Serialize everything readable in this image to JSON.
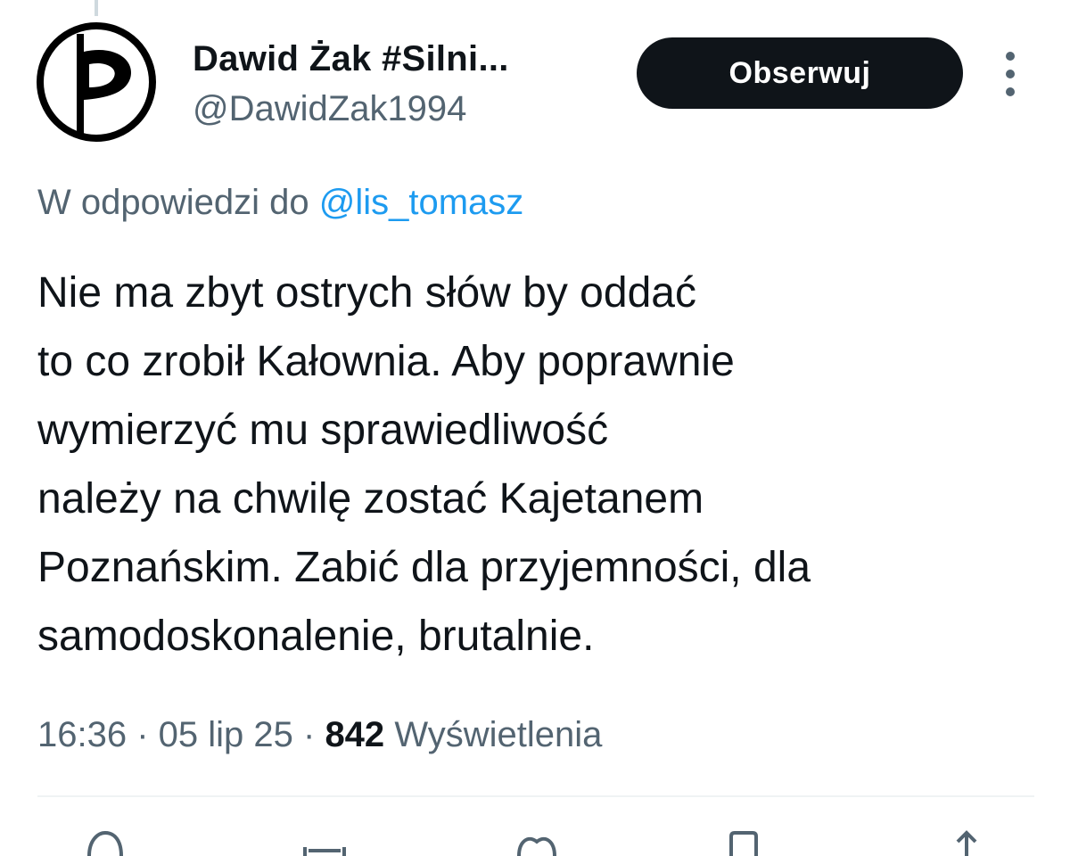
{
  "author": {
    "display_name": "Dawid Żak #Silni...",
    "handle": "@DawidZak1994",
    "avatar_icon": "pirate-party-flag-logo"
  },
  "follow_button": {
    "label": "Obserwuj"
  },
  "more_menu": {
    "icon": "more-vertical-icon"
  },
  "reply_context": {
    "prefix": "W odpowiedzi do",
    "mention": "@lis_tomasz"
  },
  "tweet": {
    "lines": [
      "Nie ma zbyt ostrych słów by oddać",
      "to co zrobił Kałownia. Aby poprawnie",
      "wymierzyć mu sprawiedliwość",
      "należy na chwilę zostać Kajetanem",
      "Poznańskim. Zabić dla przyjemności, dla",
      "samodoskonalenie, brutalnie."
    ]
  },
  "meta": {
    "time": "16:36",
    "separator": " · ",
    "date": "05 lip 25",
    "views_count": "842",
    "views_label": "Wyświetlenia"
  },
  "colors": {
    "text_primary": "#0f1419",
    "text_secondary": "#536471",
    "link": "#1d9bf0",
    "button_bg": "#0f1419",
    "divider": "#eff3f4"
  }
}
